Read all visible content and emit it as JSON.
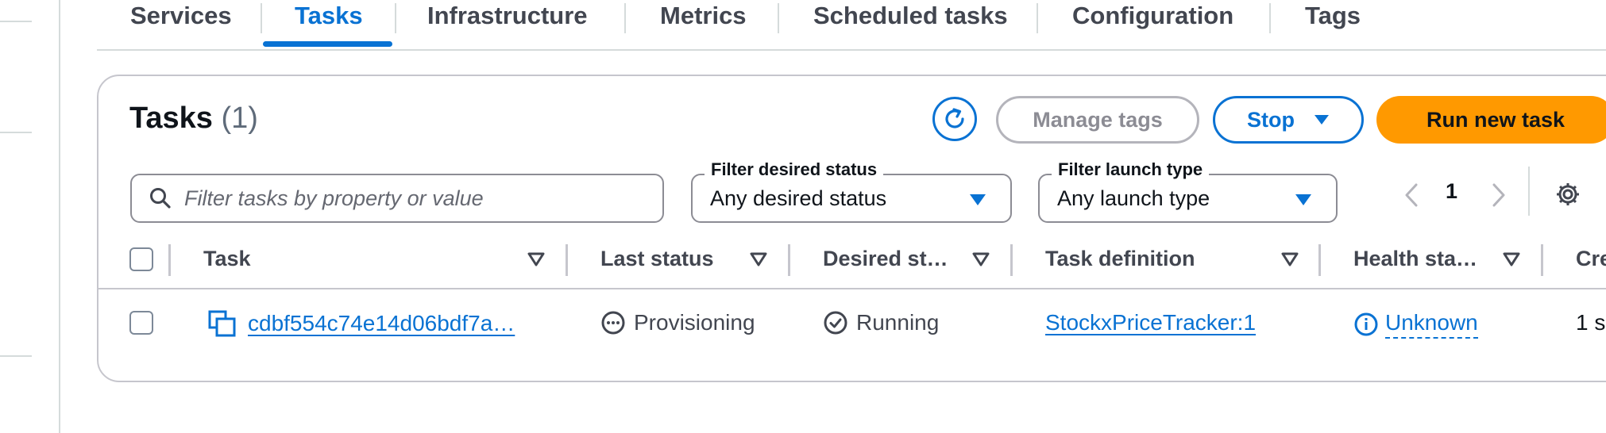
{
  "tabs": [
    {
      "label": "Services"
    },
    {
      "label": "Tasks",
      "active": true
    },
    {
      "label": "Infrastructure"
    },
    {
      "label": "Metrics"
    },
    {
      "label": "Scheduled tasks"
    },
    {
      "label": "Configuration"
    },
    {
      "label": "Tags"
    }
  ],
  "header": {
    "title": "Tasks",
    "count": "(1)"
  },
  "actions": {
    "manage_tags": "Manage tags",
    "stop": "Stop",
    "run_new_task": "Run new task"
  },
  "search": {
    "placeholder": "Filter tasks by property or value",
    "value": ""
  },
  "filters": {
    "desired_status": {
      "label": "Filter desired status",
      "value": "Any desired status"
    },
    "launch_type": {
      "label": "Filter launch type",
      "value": "Any launch type"
    }
  },
  "pagination": {
    "page": "1"
  },
  "table": {
    "columns": [
      "Task",
      "Last status",
      "Desired st…",
      "Task definition",
      "Health sta…",
      "Cre"
    ],
    "rows": [
      {
        "task": "cdbf554c74e14d06bdf7a…",
        "last_status": "Provisioning",
        "desired_status": "Running",
        "task_definition": "StockxPriceTracker:1",
        "health_status": "Unknown",
        "created": "1 s"
      }
    ]
  },
  "colors": {
    "accent": "#0972d3",
    "primary_button": "#ff9900",
    "border": "#c6c6cd"
  },
  "icons": [
    "refresh-icon",
    "caret-down-icon",
    "search-icon",
    "chevron-left-icon",
    "chevron-right-icon",
    "settings-gear-icon",
    "sort-icon",
    "copy-icon",
    "in-progress-icon",
    "success-check-icon",
    "info-icon"
  ]
}
